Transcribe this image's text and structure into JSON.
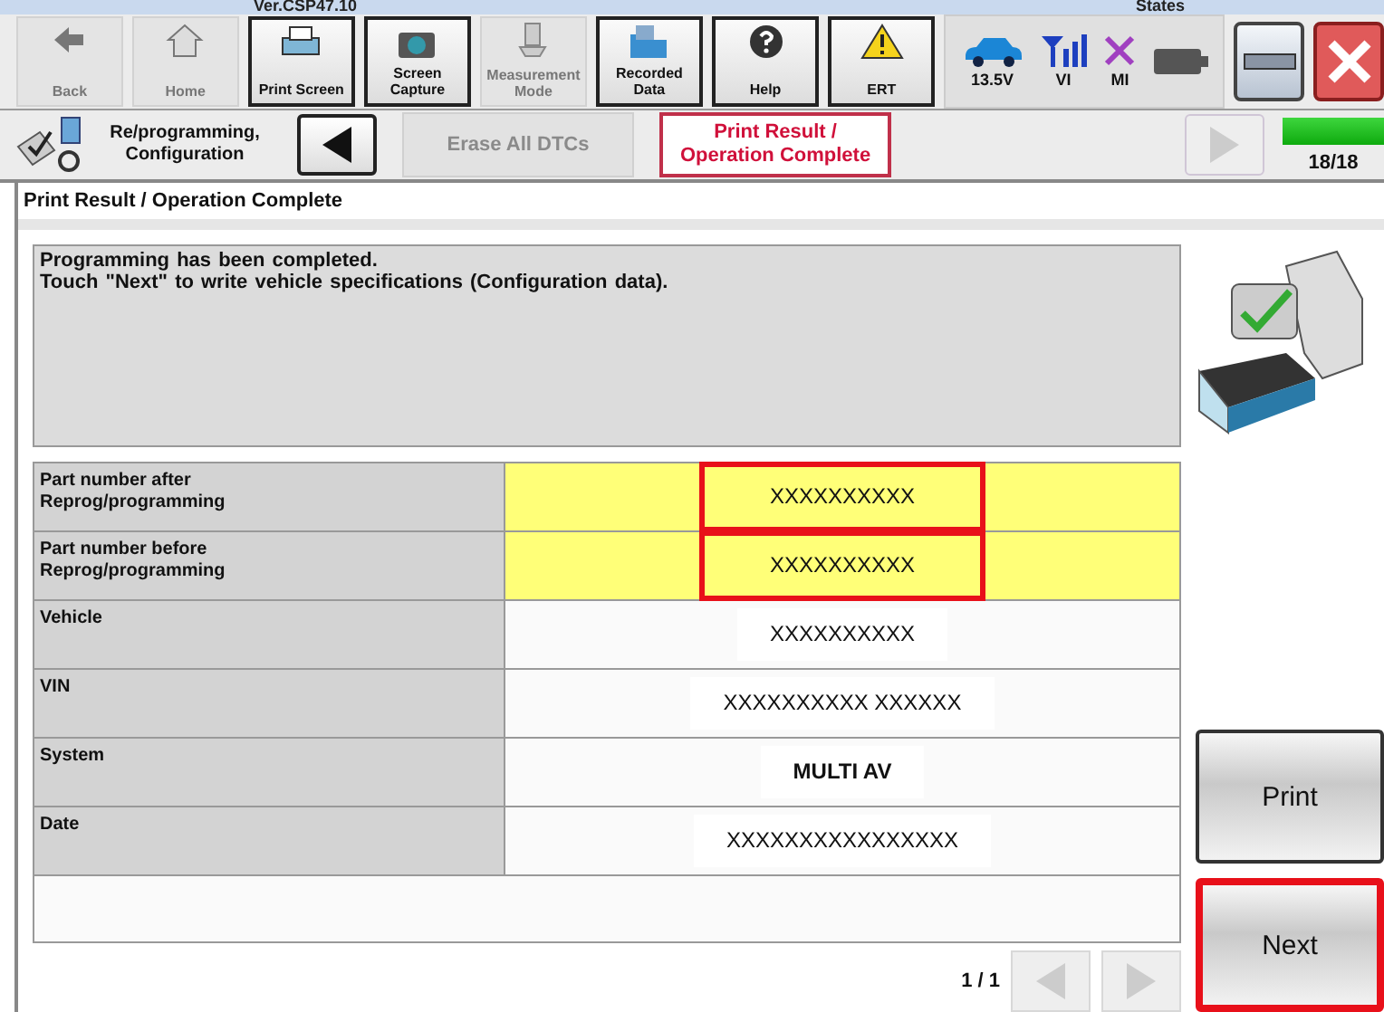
{
  "header": {
    "version": "Ver.CSP47.10",
    "states_label": "States"
  },
  "toolbar": [
    {
      "kind": "back",
      "label": "Back",
      "disabled": true
    },
    {
      "kind": "home",
      "label": "Home",
      "disabled": true
    },
    {
      "kind": "printer",
      "label": "Print Screen",
      "disabled": false
    },
    {
      "kind": "camera",
      "label": "Screen Capture",
      "disabled": false
    },
    {
      "kind": "meter",
      "label": "Measurement Mode",
      "disabled": true
    },
    {
      "kind": "folder",
      "label": "Recorded Data",
      "disabled": false
    },
    {
      "kind": "help",
      "label": "Help",
      "disabled": false
    },
    {
      "kind": "warning",
      "label": "ERT",
      "disabled": false
    }
  ],
  "status": [
    {
      "kind": "car",
      "label": "13.5V"
    },
    {
      "kind": "signal",
      "label": "VI"
    },
    {
      "kind": "cross",
      "label": "MI"
    },
    {
      "kind": "battery"
    }
  ],
  "breadcrumb": {
    "section": "Re/programming, Configuration",
    "steps": [
      {
        "label": "Erase All DTCs",
        "selected": false
      },
      {
        "label": "Print Result / Operation Complete",
        "selected": true
      }
    ],
    "forward_disabled": true,
    "progress": {
      "level": 1,
      "label": "18/18"
    }
  },
  "page_title": "Print Result / Operation Complete",
  "message": [
    "Programming has been completed.",
    "Touch \"Next\" to write vehicle specifications (Configuration data)."
  ],
  "rows": [
    {
      "label": "Part number after Reprog/programming",
      "value": "XXXXXXXXXX",
      "highlighted": true,
      "outlined": true,
      "bold": false
    },
    {
      "label": "Part number before Reprog/programming",
      "value": "XXXXXXXXXX",
      "highlighted": true,
      "outlined": true,
      "bold": false
    },
    {
      "label": "Vehicle",
      "value": "XXXXXXXXXX",
      "highlighted": false,
      "outlined": false,
      "bold": false
    },
    {
      "label": "VIN",
      "value": "XXXXXXXXXX XXXXXX",
      "highlighted": false,
      "outlined": false,
      "bold": false
    },
    {
      "label": "System",
      "value": "MULTI AV",
      "highlighted": false,
      "outlined": false,
      "bold": true
    },
    {
      "label": "Date",
      "value": "XXXXXXXXXXXXXXXX",
      "highlighted": false,
      "outlined": false,
      "bold": false
    }
  ],
  "pager": {
    "label": "1 / 1",
    "prev_disabled": true,
    "next_disabled": true
  },
  "buttons": [
    {
      "label": "Print",
      "outlined": false
    },
    {
      "label": "Next",
      "outlined": true
    }
  ]
}
